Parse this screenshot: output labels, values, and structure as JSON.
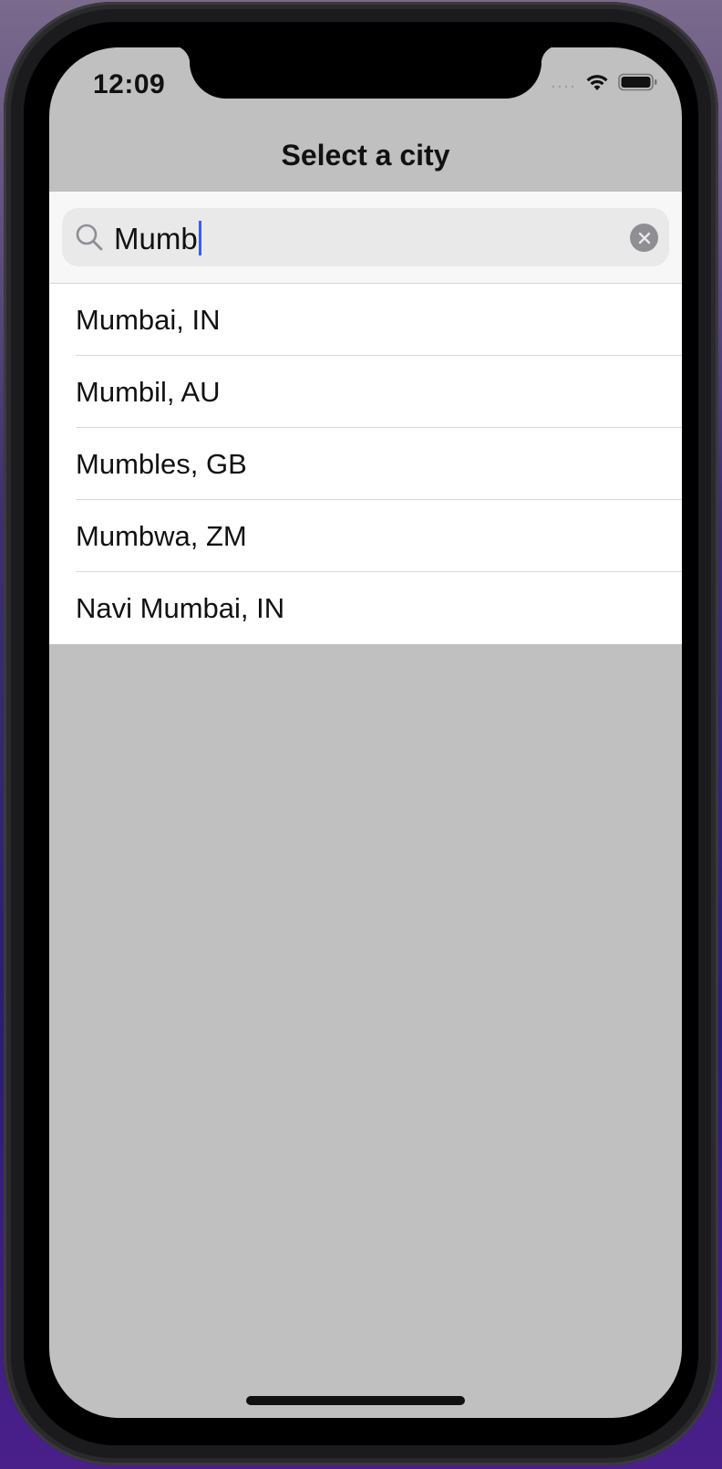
{
  "status_bar": {
    "time": "12:09",
    "signal": "․․․․",
    "wifi_icon": "wifi-icon",
    "battery_icon": "battery-icon"
  },
  "nav": {
    "title": "Select a city"
  },
  "search": {
    "value": "Mumb",
    "search_icon": "search-icon",
    "clear_icon": "clear-icon"
  },
  "results": [
    {
      "label": "Mumbai, IN"
    },
    {
      "label": "Mumbil, AU"
    },
    {
      "label": "Mumbles, GB"
    },
    {
      "label": "Mumbwa, ZM"
    },
    {
      "label": "Navi Mumbai, IN"
    }
  ],
  "colors": {
    "caret": "#3b5bf5",
    "screen_background": "#c0c0c0",
    "list_background": "#ffffff"
  }
}
